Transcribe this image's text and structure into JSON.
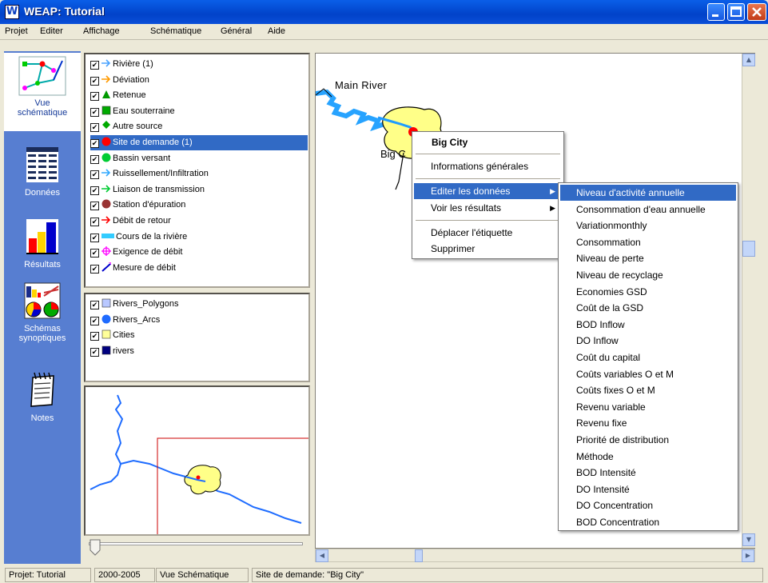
{
  "window": {
    "title": "WEAP: Tutorial",
    "app_icon": "W"
  },
  "menu": [
    "Projet",
    "Editer",
    "Affichage",
    "Schématique",
    "Général",
    "Aide"
  ],
  "left_nav": [
    {
      "label_line1": "Vue",
      "label_line2": "schématique",
      "icon": "schematic-icon",
      "active": true
    },
    {
      "label": "Données",
      "icon": "data-table-icon"
    },
    {
      "label": "Résultats",
      "icon": "bar-chart-icon"
    },
    {
      "label_line1": "Schémas",
      "label_line2": "synoptiques",
      "icon": "overview-charts-icon"
    },
    {
      "label": "Notes",
      "icon": "notepad-icon"
    }
  ],
  "layers": [
    {
      "label": "Rivière (1)",
      "symbol": "river-arrow-icon",
      "color": "#4aa3ff"
    },
    {
      "label": "Déviation",
      "symbol": "diversion-arrow-icon",
      "color": "#ff9a00"
    },
    {
      "label": "Retenue",
      "symbol": "reservoir-triangle-icon",
      "color": "#009900"
    },
    {
      "label": "Eau souterraine",
      "symbol": "groundwater-square-icon",
      "color": "#00aa00"
    },
    {
      "label": "Autre source",
      "symbol": "other-source-diamond-icon",
      "color": "#00aa00"
    },
    {
      "label": "Site de demande (1)",
      "symbol": "demand-site-circle-icon",
      "color": "#ff0000",
      "selected": true
    },
    {
      "label": "Bassin versant",
      "symbol": "catchment-circle-icon",
      "color": "#00cc33"
    },
    {
      "label": "Ruissellement/Infiltration",
      "symbol": "runoff-arrow-icon",
      "color": "#33aaff"
    },
    {
      "label": "Liaison de transmission",
      "symbol": "transmission-arrow-icon",
      "color": "#00cc33"
    },
    {
      "label": "Station d'épuration",
      "symbol": "treatment-circle-icon",
      "color": "#993333"
    },
    {
      "label": "Débit de retour",
      "symbol": "return-flow-arrow-icon",
      "color": "#ff0000"
    },
    {
      "label": "Cours de la rivière",
      "symbol": "reach-bar-icon",
      "color": "#33ccff"
    },
    {
      "label": "Exigence de débit",
      "symbol": "flow-requirement-icon",
      "color": "#ff00ff"
    },
    {
      "label": "Mesure de débit",
      "symbol": "gauge-icon",
      "color": "#0000cc"
    }
  ],
  "gis_layers": [
    {
      "label": "Rivers_Polygons",
      "symbol": "polygon-swatch-icon",
      "color": "#b9c8ff"
    },
    {
      "label": "Rivers_Arcs",
      "symbol": "arc-circle-icon",
      "color": "#1f6bff"
    },
    {
      "label": "Cities",
      "symbol": "city-swatch-icon",
      "color": "#ffff99"
    },
    {
      "label": "rivers",
      "symbol": "rivers-swatch-icon",
      "color": "#000080"
    }
  ],
  "map": {
    "river_label": "Main River",
    "city_label_partial": "Big C"
  },
  "context_menu": {
    "header": "Big City",
    "items": [
      "Informations générales",
      "Editer les données",
      "Voir les résultats",
      "Déplacer l'étiquette",
      "Supprimer"
    ],
    "highlighted": "Editer les données"
  },
  "submenu": [
    "Niveau d'activité annuelle",
    "Consommation d'eau annuelle",
    "Variationmonthly",
    "Consommation",
    "Niveau de perte",
    "Niveau de recyclage",
    "Economies GSD",
    "Coût de la GSD",
    "BOD Inflow",
    "DO Inflow",
    "Coût du capital",
    "Coûts variables O et M",
    "Coûts fixes O et M",
    "Revenu variable",
    "Revenu fixe",
    "Priorité de distribution",
    "Méthode",
    "BOD Intensité",
    "DO Intensité",
    "DO Concentration",
    "BOD Concentration"
  ],
  "status": {
    "project": "Projet: Tutorial",
    "years": "2000-2005",
    "view": "Vue Schématique",
    "selection": "Site de demande: \"Big City\""
  },
  "colors": {
    "accent": "#316ac5",
    "titlebar": "#0a5fe8",
    "leftbar": "#577ed1"
  }
}
